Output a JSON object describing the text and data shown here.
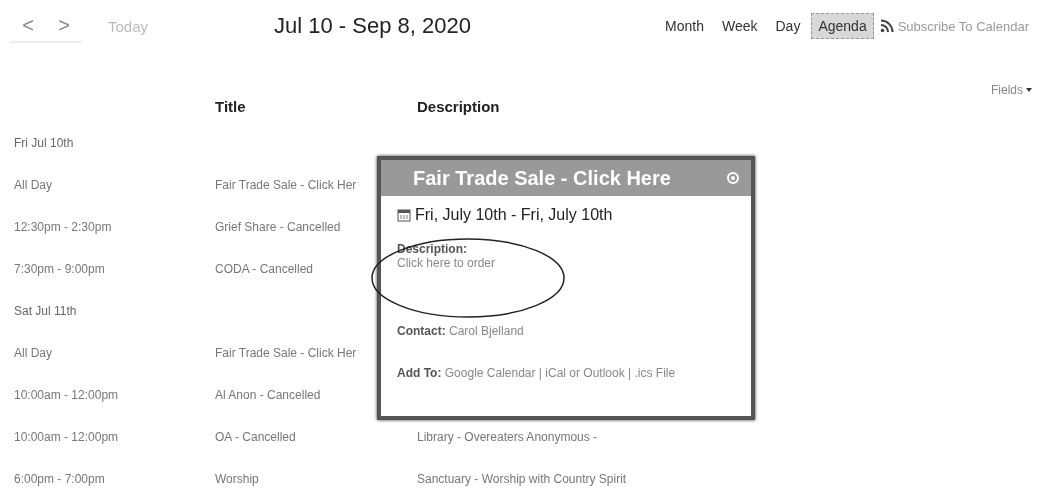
{
  "toolbar": {
    "prev": "<",
    "next": ">",
    "today": "Today",
    "range_title": "Jul 10 - Sep 8, 2020",
    "views": [
      {
        "label": "Month",
        "selected": false
      },
      {
        "label": "Week",
        "selected": false
      },
      {
        "label": "Day",
        "selected": false
      },
      {
        "label": "Agenda",
        "selected": true
      }
    ],
    "subscribe": "Subscribe To Calendar",
    "fields": "Fields"
  },
  "columns": [
    "Title",
    "Description"
  ],
  "agenda": [
    {
      "kind": "date",
      "label": "Fri Jul 10th"
    },
    {
      "kind": "event",
      "time": "All Day",
      "title": "Fair Trade Sale - Click Her"
    },
    {
      "kind": "event",
      "time": "12:30pm - 2:30pm",
      "title": "Grief Share - Cancelled"
    },
    {
      "kind": "event",
      "time": "7:30pm - 9:00pm",
      "title": "CODA - Cancelled"
    },
    {
      "kind": "date",
      "label": "Sat Jul 11th"
    },
    {
      "kind": "event",
      "time": "All Day",
      "title": "Fair Trade Sale - Click Her"
    },
    {
      "kind": "event",
      "time": "10:00am - 12:00pm",
      "title": "Al Anon - Cancelled"
    },
    {
      "kind": "event",
      "time": "10:00am - 12:00pm",
      "title": "OA - Cancelled",
      "description": "Library - Overeaters Anonymous -"
    },
    {
      "kind": "event",
      "time": "6:00pm - 7:00pm",
      "title": "Worship",
      "description": "Sanctuary - Worship with Country Spirit"
    }
  ],
  "popup": {
    "title": "Fair Trade Sale - Click Here",
    "dates": "Fri, July 10th - Fri, July 10th",
    "description_label": "Description:",
    "description": "Click here to order",
    "contact_label": "Contact:",
    "contact": "Carol Bjelland",
    "add_to_label": "Add To:",
    "add_to_links": [
      "Google Calendar",
      "iCal or Outlook",
      ".ics File"
    ],
    "separator": "|"
  }
}
